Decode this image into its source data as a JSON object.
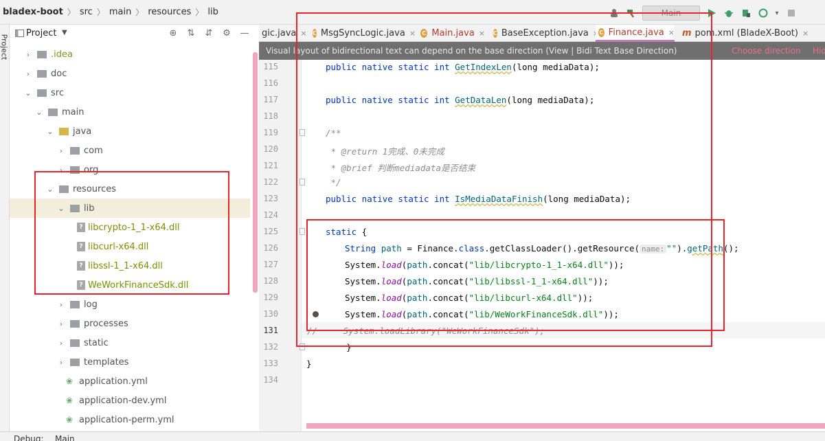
{
  "breadcrumb": [
    "bladex-boot",
    "src",
    "main",
    "resources",
    "lib"
  ],
  "toolbar": {
    "run_config": "Main"
  },
  "side_stripe": {
    "label": "Project"
  },
  "project_panel": {
    "title": "Project"
  },
  "tree": [
    {
      "label": ".idea",
      "depth": 1,
      "arrow": "›",
      "icon": "folder",
      "style": "idea"
    },
    {
      "label": "doc",
      "depth": 1,
      "arrow": "›",
      "icon": "folder"
    },
    {
      "label": "src",
      "depth": 1,
      "arrow": "⌄",
      "icon": "folder"
    },
    {
      "label": "main",
      "depth": 2,
      "arrow": "⌄",
      "icon": "folder"
    },
    {
      "label": "java",
      "depth": 3,
      "arrow": "⌄",
      "icon": "source-folder"
    },
    {
      "label": "com",
      "depth": 4,
      "arrow": "›",
      "icon": "package"
    },
    {
      "label": "org",
      "depth": 4,
      "arrow": "›",
      "icon": "package"
    },
    {
      "label": "resources",
      "depth": 3,
      "arrow": "⌄",
      "icon": "resources-folder"
    },
    {
      "label": "lib",
      "depth": 4,
      "arrow": "⌄",
      "icon": "folder",
      "selected": true
    },
    {
      "label": "libcrypto-1_1-x64.dll",
      "depth": 5,
      "arrow": "",
      "icon": "dll",
      "style": "dll"
    },
    {
      "label": "libcurl-x64.dll",
      "depth": 5,
      "arrow": "",
      "icon": "dll",
      "style": "dll"
    },
    {
      "label": "libssl-1_1-x64.dll",
      "depth": 5,
      "arrow": "",
      "icon": "dll",
      "style": "dll"
    },
    {
      "label": "WeWorkFinanceSdk.dll",
      "depth": 5,
      "arrow": "",
      "icon": "dll",
      "style": "dll"
    },
    {
      "label": "log",
      "depth": 4,
      "arrow": "›",
      "icon": "folder"
    },
    {
      "label": "processes",
      "depth": 4,
      "arrow": "›",
      "icon": "folder"
    },
    {
      "label": "static",
      "depth": 4,
      "arrow": "›",
      "icon": "folder"
    },
    {
      "label": "templates",
      "depth": 4,
      "arrow": "›",
      "icon": "folder"
    },
    {
      "label": "application.yml",
      "depth": 4,
      "arrow": "",
      "icon": "yml"
    },
    {
      "label": "application-dev.yml",
      "depth": 4,
      "arrow": "",
      "icon": "yml"
    },
    {
      "label": "application-perm.yml",
      "depth": 4,
      "arrow": "",
      "icon": "yml"
    }
  ],
  "tabs": [
    {
      "label": "gic.java",
      "icon": "",
      "close": true
    },
    {
      "label": "MsgSyncLogic.java",
      "icon": "class",
      "close": true
    },
    {
      "label": "Main.java",
      "icon": "class",
      "close": true,
      "modified": true
    },
    {
      "label": "BaseException.java",
      "icon": "class",
      "close": true
    },
    {
      "label": "Finance.java",
      "icon": "class",
      "close": true,
      "active": true,
      "modified": true
    },
    {
      "label": "pom.xml (BladeX-Boot)",
      "icon": "maven",
      "close": true
    }
  ],
  "notification": {
    "message": "Visual layout of bidirectional text can depend on the base direction (View | Bidi Text Base Direction)",
    "action1": "Choose direction",
    "action2": "Hid"
  },
  "editor": {
    "current_line": "131",
    "lines": [
      {
        "n": "115"
      },
      {
        "n": "116"
      },
      {
        "n": "117"
      },
      {
        "n": "118"
      },
      {
        "n": "119"
      },
      {
        "n": "120"
      },
      {
        "n": "121"
      },
      {
        "n": "122"
      },
      {
        "n": "123"
      },
      {
        "n": "124"
      },
      {
        "n": "125"
      },
      {
        "n": "126"
      },
      {
        "n": "127"
      },
      {
        "n": "128"
      },
      {
        "n": "129"
      },
      {
        "n": "130"
      },
      {
        "n": "131"
      },
      {
        "n": "132"
      },
      {
        "n": "133"
      },
      {
        "n": "134"
      }
    ],
    "code": {
      "l115_mod": "public native static int ",
      "l115_fn": "GetIndexLen",
      "l115_rest": "(long mediaData);",
      "l117_mod": "public native static int ",
      "l117_fn": "GetDataLen",
      "l117_rest": "(long mediaData);",
      "l119": "/**",
      "l120": " * @return 1完成、0未完成",
      "l121": " * @brief 判断mediadata是否结束",
      "l122": " */",
      "l123_mod": "public native static int ",
      "l123_fn": "IsMediaDataFinish",
      "l123_rest": "(long mediaData);",
      "l125_kw": "static",
      "l125_rest": " {",
      "l126_type": "String ",
      "l126_var": "path",
      "l126_mid": " = Finance.",
      "l126_kw": "class",
      "l126_call": ".getClassLoader().getResource(",
      "l126_hint": "name:",
      "l126_str": "\"\"",
      "l126_end": ").",
      "l126_fn": "getPath",
      "l126_tail": "();",
      "l127_sys": "System.",
      "l127_load": "load",
      "l127_open": "(",
      "l127_var": "path",
      "l127_concat": ".concat(",
      "l127_str": "\"lib/libcrypto-1_1-x64.dll\"",
      "l127_close": "));",
      "l128_sys": "System.",
      "l128_load": "load",
      "l128_open": "(",
      "l128_var": "path",
      "l128_concat": ".concat(",
      "l128_str": "\"lib/libssl-1_1-x64.dll\"",
      "l128_close": "));",
      "l129_sys": "System.",
      "l129_load": "load",
      "l129_open": "(",
      "l129_var": "path",
      "l129_concat": ".concat(",
      "l129_str": "\"lib/libcurl-x64.dll\"",
      "l129_close": "));",
      "l130_sys": "System.",
      "l130_load": "load",
      "l130_open": "(",
      "l130_var": "path",
      "l130_concat": ".concat(",
      "l130_str": "\"lib/WeWorkFinanceSdk.dll\"",
      "l130_close": "));",
      "l131": "//     System.loadLibrary(\"WeWorkFinanceSdk\");",
      "l132": "    }",
      "l133": "}"
    }
  },
  "bottom": {
    "debug_label": "Debug:",
    "main_tab": "Main"
  },
  "colors": {
    "annotation_red": "#e8232a",
    "scroll_pink": "#f0a6bd",
    "dll_text": "#7b8f00"
  }
}
